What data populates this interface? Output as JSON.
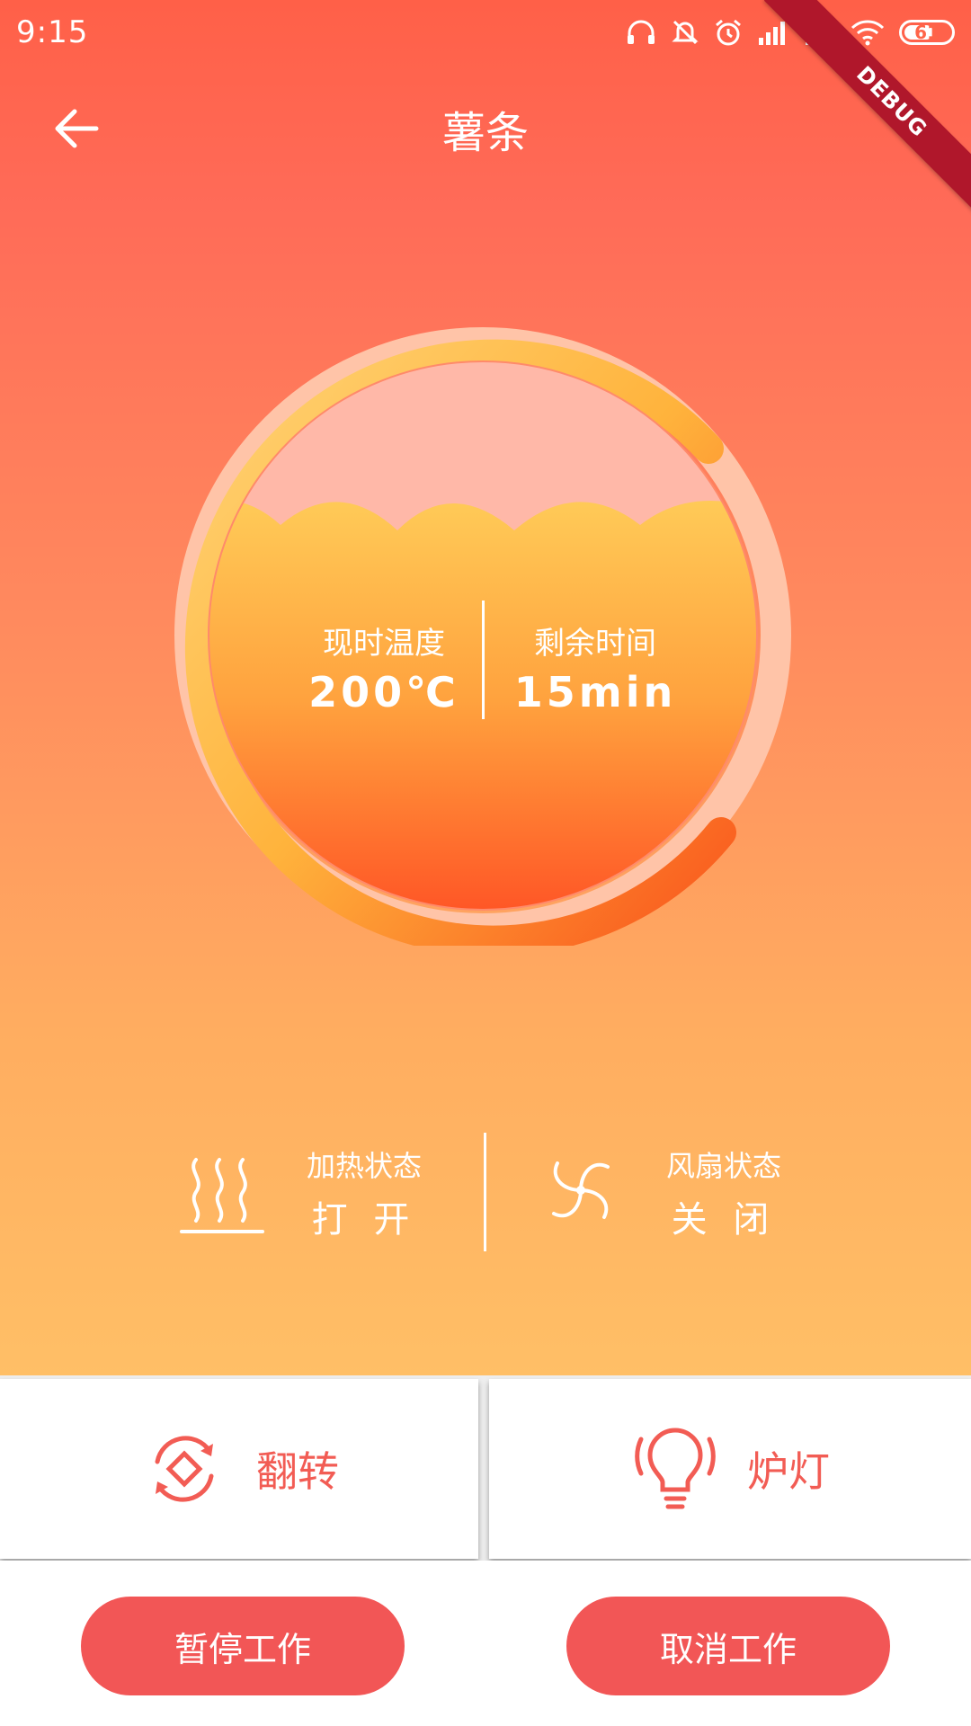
{
  "status_bar": {
    "time": "9:15",
    "battery_level": "61"
  },
  "app_bar": {
    "title": "薯条",
    "debug_banner": "DEBUG"
  },
  "gauge": {
    "temperature_label": "现时温度",
    "temperature_value": "200℃",
    "remaining_label": "剩余时间",
    "remaining_value": "15min"
  },
  "device_status": {
    "heating_label": "加热状态",
    "heating_value": "打 开",
    "fan_label": "风扇状态",
    "fan_value": "关 闭"
  },
  "actions": {
    "flip_label": "翻转",
    "lamp_label": "炉灯"
  },
  "buttons": {
    "pause_label": "暂停工作",
    "cancel_label": "取消工作"
  },
  "colors": {
    "accent": "#f25656",
    "gradient_top": "#ff6048",
    "gradient_bottom": "#ffbf66",
    "debug_ribbon": "#b0172b"
  }
}
